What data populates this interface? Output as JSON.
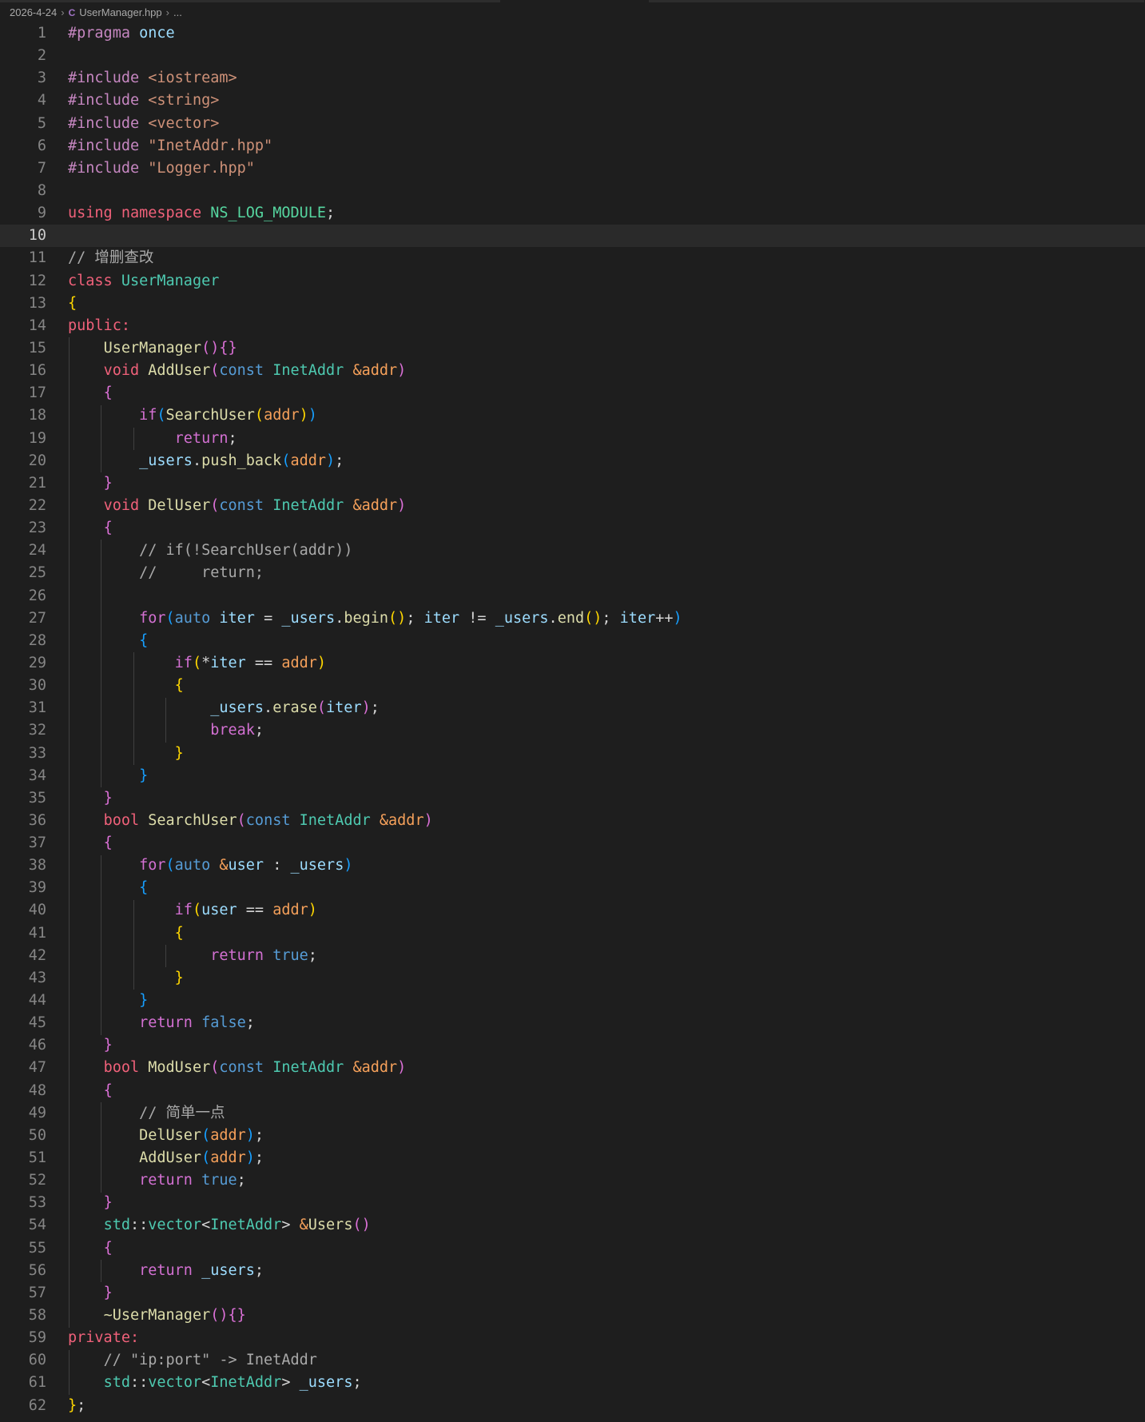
{
  "breadcrumb": {
    "folder": "2026-4-24",
    "file": "UserManager.hpp",
    "more": "..."
  },
  "editor": {
    "current_line": 10,
    "lines": [
      {
        "n": "1",
        "code": "#pragma once"
      },
      {
        "n": "2",
        "code": ""
      },
      {
        "n": "3",
        "code": "#include <iostream>"
      },
      {
        "n": "4",
        "code": "#include <string>"
      },
      {
        "n": "5",
        "code": "#include <vector>"
      },
      {
        "n": "6",
        "code": "#include \"InetAddr.hpp\""
      },
      {
        "n": "7",
        "code": "#include \"Logger.hpp\""
      },
      {
        "n": "8",
        "code": ""
      },
      {
        "n": "9",
        "code": "using namespace NS_LOG_MODULE;"
      },
      {
        "n": "10",
        "code": ""
      },
      {
        "n": "11",
        "code": "// 增删查改"
      },
      {
        "n": "12",
        "code": "class UserManager"
      },
      {
        "n": "13",
        "code": "{"
      },
      {
        "n": "14",
        "code": "public:"
      },
      {
        "n": "15",
        "code": "    UserManager(){}"
      },
      {
        "n": "16",
        "code": "    void AddUser(const InetAddr &addr)"
      },
      {
        "n": "17",
        "code": "    {"
      },
      {
        "n": "18",
        "code": "        if(SearchUser(addr))"
      },
      {
        "n": "19",
        "code": "            return;"
      },
      {
        "n": "20",
        "code": "        _users.push_back(addr);"
      },
      {
        "n": "21",
        "code": "    }"
      },
      {
        "n": "22",
        "code": "    void DelUser(const InetAddr &addr)"
      },
      {
        "n": "23",
        "code": "    {"
      },
      {
        "n": "24",
        "code": "        // if(!SearchUser(addr))"
      },
      {
        "n": "25",
        "code": "        //     return;"
      },
      {
        "n": "26",
        "code": ""
      },
      {
        "n": "27",
        "code": "        for(auto iter = _users.begin(); iter != _users.end(); iter++)"
      },
      {
        "n": "28",
        "code": "        {"
      },
      {
        "n": "29",
        "code": "            if(*iter == addr)"
      },
      {
        "n": "30",
        "code": "            {"
      },
      {
        "n": "31",
        "code": "                _users.erase(iter);"
      },
      {
        "n": "32",
        "code": "                break;"
      },
      {
        "n": "33",
        "code": "            }"
      },
      {
        "n": "34",
        "code": "        }"
      },
      {
        "n": "35",
        "code": "    }"
      },
      {
        "n": "36",
        "code": "    bool SearchUser(const InetAddr &addr)"
      },
      {
        "n": "37",
        "code": "    {"
      },
      {
        "n": "38",
        "code": "        for(auto &user : _users)"
      },
      {
        "n": "39",
        "code": "        {"
      },
      {
        "n": "40",
        "code": "            if(user == addr)"
      },
      {
        "n": "41",
        "code": "            {"
      },
      {
        "n": "42",
        "code": "                return true;"
      },
      {
        "n": "43",
        "code": "            }"
      },
      {
        "n": "44",
        "code": "        }"
      },
      {
        "n": "45",
        "code": "        return false;"
      },
      {
        "n": "46",
        "code": "    }"
      },
      {
        "n": "47",
        "code": "    bool ModUser(const InetAddr &addr)"
      },
      {
        "n": "48",
        "code": "    {"
      },
      {
        "n": "49",
        "code": "        // 简单一点"
      },
      {
        "n": "50",
        "code": "        DelUser(addr);"
      },
      {
        "n": "51",
        "code": "        AddUser(addr);"
      },
      {
        "n": "52",
        "code": "        return true;"
      },
      {
        "n": "53",
        "code": "    }"
      },
      {
        "n": "54",
        "code": "    std::vector<InetAddr> &Users()"
      },
      {
        "n": "55",
        "code": "    {"
      },
      {
        "n": "56",
        "code": "        return _users;"
      },
      {
        "n": "57",
        "code": "    }"
      },
      {
        "n": "58",
        "code": "    ~UserManager(){}"
      },
      {
        "n": "59",
        "code": "private:"
      },
      {
        "n": "60",
        "code": "    // \"ip:port\" -> InetAddr"
      },
      {
        "n": "61",
        "code": "    std::vector<InetAddr> _users;"
      },
      {
        "n": "62",
        "code": "};"
      }
    ]
  },
  "colors": {
    "background": "#1e1e1e",
    "current_line": "#2a2a2a",
    "line_number": "#858585",
    "keyword_red": "#f0617a",
    "preprocessor": "#c586c0",
    "type": "#4ec9b0",
    "function": "#dcdcaa",
    "parameter": "#f5a05a",
    "comment": "#a9a9a9"
  }
}
